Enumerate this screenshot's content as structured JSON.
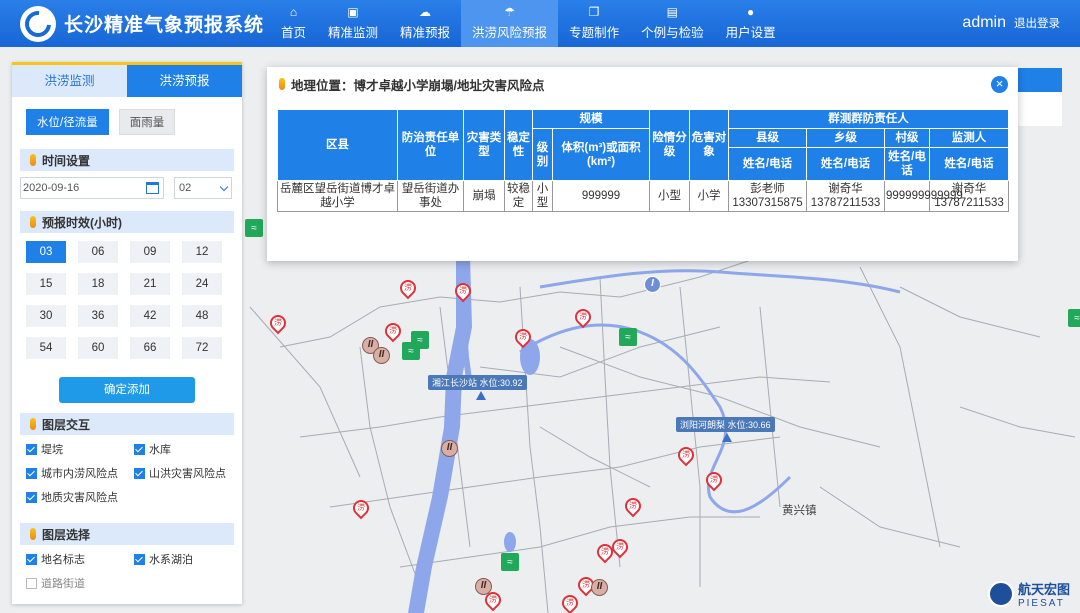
{
  "header": {
    "title": "长沙精准气象预报系统",
    "nav": [
      {
        "label": "首页",
        "icon": "home-icon",
        "glyph": "⌂"
      },
      {
        "label": "精准监测",
        "icon": "monitor-icon",
        "glyph": "▣"
      },
      {
        "label": "精准预报",
        "icon": "weather-icon",
        "glyph": "☁"
      },
      {
        "label": "洪涝风险预报",
        "icon": "flood-icon",
        "glyph": "☂"
      },
      {
        "label": "专题制作",
        "icon": "document-icon",
        "glyph": "❐"
      },
      {
        "label": "个例与检验",
        "icon": "check-icon",
        "glyph": "▤"
      },
      {
        "label": "用户设置",
        "icon": "user-icon",
        "glyph": "●"
      }
    ],
    "active_nav": 3,
    "username": "admin",
    "logout": "退出登录"
  },
  "panel": {
    "tabs": [
      "洪涝监测",
      "洪涝预报"
    ],
    "active_tab": 1,
    "subtabs": [
      "水位/径流量",
      "面雨量"
    ],
    "time_section": "时间设置",
    "date_value": "2020-09-16",
    "hour_value": "02",
    "forecast_section": "预报时效(小时)",
    "hours": [
      "03",
      "06",
      "09",
      "12",
      "15",
      "18",
      "21",
      "24",
      "30",
      "36",
      "42",
      "48",
      "54",
      "60",
      "66",
      "72"
    ],
    "confirm": "确定添加",
    "layer_section": "图层交互",
    "layers": [
      {
        "label": "堤垸",
        "checked": true
      },
      {
        "label": "水库",
        "checked": true
      },
      {
        "label": "城市内涝风险点",
        "checked": true
      },
      {
        "label": "山洪灾害风险点",
        "checked": true
      },
      {
        "label": "地质灾害风险点",
        "checked": true
      }
    ],
    "select_section": "图层选择",
    "selects": [
      {
        "label": "地名标志",
        "checked": true
      },
      {
        "label": "水系湖泊",
        "checked": true
      },
      {
        "label": "道路街道",
        "checked": false
      }
    ]
  },
  "popup": {
    "title": "地理位置：博才卓越小学崩塌/地址灾害风险点",
    "close_glyph": "×",
    "headers": {
      "district": "区县",
      "unit": "防治责任单位",
      "type": "灾害类型",
      "stability": "稳定性",
      "scale": "规模",
      "level": "级别",
      "volume": "体积(m³)或面积(km²)",
      "danger": "险情分级",
      "object": "危害对象",
      "group": "群测群防责任人",
      "county": "县级",
      "township": "乡级",
      "village": "村级",
      "monitor": "监测人",
      "name_phone": "姓名/电话"
    },
    "row": {
      "district": "岳麓区望岳街道博才卓越小学",
      "unit": "望岳街道办事处",
      "type": "崩塌",
      "stability": "较稳定",
      "level": "小型",
      "volume": "999999",
      "danger": "小型",
      "object": "小学",
      "county": "彭老师13307315875",
      "township": "谢奇华13787211533",
      "village": "999999999999",
      "monitor": "谢奇华13787211533"
    }
  },
  "map": {
    "stations": [
      "湘江长沙站 水位:30.92",
      "浏阳河朗梨 水位:30.66"
    ],
    "town": "黄兴镇",
    "marker_glyph": "涝",
    "ii_glyph": "II",
    "i_glyph": "I",
    "watermark_cn": "航天宏图",
    "watermark_en": "PIESAT"
  }
}
